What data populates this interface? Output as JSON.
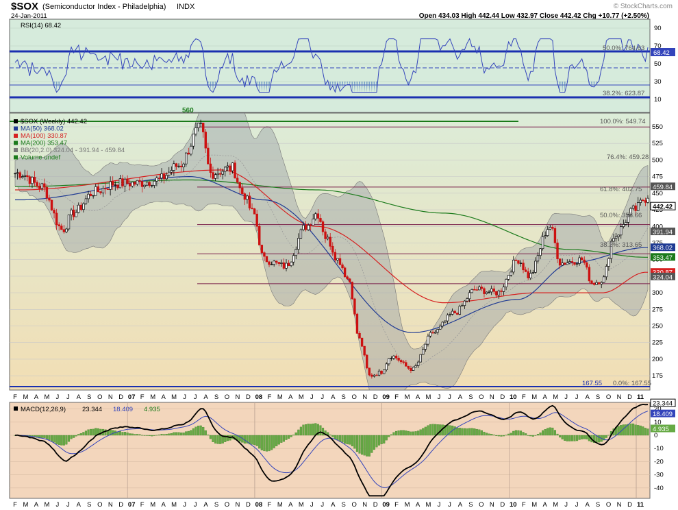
{
  "header": {
    "symbol": "$SOX",
    "name": "(Semiconductor Index - Philadelphia)",
    "exchange": "INDX",
    "date": "24-Jan-2011",
    "ohlc": "Open 434.03  High 442.44  Low 432.97  Close 442.42  Chg +10.77 (+2.50%)",
    "watermark": "© StockCharts.com"
  },
  "rsi_panel": {
    "label": "RSI(14) 68.42",
    "last_value_label": "68.42",
    "y_ticks": [
      "90",
      "70",
      "50",
      "30",
      "10"
    ],
    "fib_labels": [
      "50.0%: 764.63",
      "38.2%: 623.87"
    ],
    "extra_label": "560"
  },
  "price_panel": {
    "legend": [
      {
        "text": "$SOX (Weekly) 442.42",
        "color": "#000000"
      },
      {
        "text": "MA(50) 368.02",
        "color": "#1f3a93"
      },
      {
        "text": "MA(100) 330.87",
        "color": "#d62020"
      },
      {
        "text": "MA(200) 353.47",
        "color": "#1a7a1a"
      },
      {
        "text": "BB(20,2.0) 324.04 - 391.94 - 459.84",
        "color": "#777777"
      },
      {
        "text": "Volume undef",
        "color": "#1a7a1a"
      }
    ],
    "y_ticks": [
      "550",
      "525",
      "500",
      "475",
      "450",
      "425",
      "400",
      "375",
      "350",
      "325",
      "300",
      "275",
      "250",
      "225",
      "200",
      "175"
    ],
    "fib_labels": [
      "100.0%: 549.74",
      "76.4%: 459.28",
      "61.8%: 402.75",
      "50.0%: 358.66",
      "38.2%: 313.65",
      "0.0%: 167.55"
    ],
    "low_label": "167.55",
    "right_labels": [
      "459.84",
      "442.42",
      "391.94",
      "368.02",
      "353.47",
      "330.87",
      "324.04"
    ]
  },
  "x_axis": {
    "labels": [
      "F",
      "M",
      "A",
      "M",
      "J",
      "J",
      "A",
      "S",
      "O",
      "N",
      "D",
      "07",
      "F",
      "M",
      "A",
      "M",
      "J",
      "J",
      "A",
      "S",
      "O",
      "N",
      "D",
      "08",
      "F",
      "M",
      "A",
      "M",
      "J",
      "J",
      "A",
      "S",
      "O",
      "N",
      "D",
      "09",
      "F",
      "M",
      "A",
      "M",
      "J",
      "J",
      "A",
      "S",
      "O",
      "N",
      "D",
      "10",
      "F",
      "M",
      "A",
      "M",
      "J",
      "J",
      "A",
      "S",
      "O",
      "N",
      "D",
      "11"
    ]
  },
  "macd_panel": {
    "label": "MACD(12,26,9)",
    "macd_value": "23.344",
    "signal_value": "18.409",
    "hist_value": "4.935",
    "y_ticks": [
      "20",
      "10",
      "0",
      "-10",
      "-20",
      "-30",
      "-40"
    ],
    "right_labels": [
      "23.344",
      "18.409",
      "4.935"
    ]
  },
  "colors": {
    "rsi_bg": "#d6ebdc",
    "price_bg_top": "#dcecd8",
    "price_bg_bottom": "#f2deb4",
    "macd_bg": "#f3d6bc",
    "up_candle": "#000000",
    "down_candle": "#cc1111",
    "ma50": "#1f3a93",
    "ma100": "#d62020",
    "ma200": "#1a7a1a",
    "rsi_line": "#3344bb",
    "macd_line": "#000000",
    "signal_line": "#3344bb",
    "hist": "#66aa44"
  },
  "chart_data": {
    "type": "line",
    "title": "$SOX (Semiconductor Index - Philadelphia) INDX",
    "period": "Weekly",
    "x_start": "2006-02",
    "x_end": "2011-01",
    "ylim": [
      160,
      570
    ],
    "price_path": [
      [
        "2006-02",
        480
      ],
      [
        "2006-04",
        460
      ],
      [
        "2006-06",
        395
      ],
      [
        "2006-07",
        420
      ],
      [
        "2006-09",
        452
      ],
      [
        "2006-11",
        465
      ],
      [
        "2007-01",
        465
      ],
      [
        "2007-03",
        470
      ],
      [
        "2007-05",
        492
      ],
      [
        "2007-07",
        548
      ],
      [
        "2007-08",
        480
      ],
      [
        "2007-10",
        488
      ],
      [
        "2007-11",
        450
      ],
      [
        "2007-12",
        420
      ],
      [
        "2008-01",
        350
      ],
      [
        "2008-03",
        340
      ],
      [
        "2008-05",
        400
      ],
      [
        "2008-06",
        420
      ],
      [
        "2008-07",
        380
      ],
      [
        "2008-08",
        350
      ],
      [
        "2008-09",
        320
      ],
      [
        "2008-10",
        230
      ],
      [
        "2008-11",
        175
      ],
      [
        "2008-12",
        180
      ],
      [
        "2009-01",
        205
      ],
      [
        "2009-03",
        185
      ],
      [
        "2009-05",
        240
      ],
      [
        "2009-07",
        270
      ],
      [
        "2009-09",
        305
      ],
      [
        "2009-11",
        300
      ],
      [
        "2010-01",
        350
      ],
      [
        "2010-02",
        325
      ],
      [
        "2010-04",
        400
      ],
      [
        "2010-05",
        345
      ],
      [
        "2010-07",
        350
      ],
      [
        "2010-08",
        315
      ],
      [
        "2010-09",
        320
      ],
      [
        "2010-10",
        385
      ],
      [
        "2010-12",
        425
      ],
      [
        "2011-01",
        442.42
      ]
    ],
    "ma50": [
      [
        "2006-02",
        440
      ],
      [
        "2007-06",
        475
      ],
      [
        "2008-01",
        440
      ],
      [
        "2009-03",
        240
      ],
      [
        "2010-01",
        290
      ],
      [
        "2010-06",
        345
      ],
      [
        "2011-01",
        368.02
      ]
    ],
    "ma100": [
      [
        "2006-02",
        455
      ],
      [
        "2007-09",
        485
      ],
      [
        "2008-06",
        400
      ],
      [
        "2009-06",
        285
      ],
      [
        "2010-03",
        300
      ],
      [
        "2010-09",
        300
      ],
      [
        "2011-01",
        330.87
      ]
    ],
    "ma200": [
      [
        "2006-02",
        460
      ],
      [
        "2007-06",
        470
      ],
      [
        "2008-06",
        455
      ],
      [
        "2009-06",
        420
      ],
      [
        "2010-06",
        365
      ],
      [
        "2011-01",
        353.47
      ]
    ],
    "fib_levels": [
      {
        "label": "100.0%",
        "value": 549.74
      },
      {
        "label": "76.4%",
        "value": 459.28
      },
      {
        "label": "61.8%",
        "value": 402.75
      },
      {
        "label": "50.0%",
        "value": 358.66
      },
      {
        "label": "38.2%",
        "value": 313.65
      },
      {
        "label": "0.0%",
        "value": 167.55
      }
    ],
    "rsi": {
      "ylim": [
        0,
        100
      ],
      "last": 68.42,
      "upper": 70,
      "lower": 30
    },
    "macd": {
      "ylim": [
        -48,
        30
      ],
      "macd": 23.344,
      "signal": 18.409,
      "histogram": 4.935
    }
  }
}
